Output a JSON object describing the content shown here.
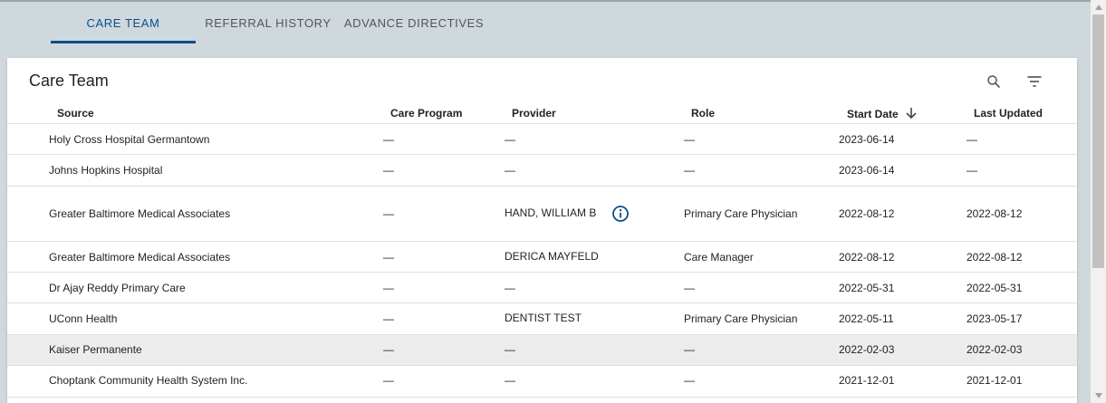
{
  "tabs": [
    {
      "label": "CARE TEAM",
      "active": true
    },
    {
      "label": "REFERRAL HISTORY",
      "active": false
    },
    {
      "label": "ADVANCE DIRECTIVES",
      "active": false
    }
  ],
  "card": {
    "title": "Care Team",
    "search_icon": "search-icon",
    "filter_icon": "filter-icon"
  },
  "table": {
    "columns": {
      "source": "Source",
      "care_program": "Care Program",
      "provider": "Provider",
      "role": "Role",
      "start_date": "Start Date",
      "last_updated": "Last Updated"
    },
    "sort": {
      "column": "Start Date",
      "direction": "descending",
      "icon": "arrow-down-icon"
    },
    "rows": [
      {
        "source": "Holy Cross Hospital Germantown",
        "care_program": "—",
        "provider": "—",
        "role": "—",
        "start_date": "2023-06-14",
        "last_updated": "—"
      },
      {
        "source": "Johns Hopkins Hospital",
        "care_program": "—",
        "provider": "—",
        "role": "—",
        "start_date": "2023-06-14",
        "last_updated": "—"
      },
      {
        "source": "Greater Baltimore Medical Associates",
        "care_program": "—",
        "provider": "HAND, WILLIAM B",
        "role": "Primary Care Physician",
        "start_date": "2022-08-12",
        "last_updated": "2022-08-12",
        "info_icon": true
      },
      {
        "source": "Greater Baltimore Medical Associates",
        "care_program": "—",
        "provider": "DERICA MAYFELD",
        "role": "Care Manager",
        "start_date": "2022-08-12",
        "last_updated": "2022-08-12"
      },
      {
        "source": "Dr Ajay Reddy Primary Care",
        "care_program": "—",
        "provider": "—",
        "role": "—",
        "start_date": "2022-05-31",
        "last_updated": "2022-05-31"
      },
      {
        "source": "UConn Health",
        "care_program": "—",
        "provider": "DENTIST TEST",
        "role": "Primary Care Physician",
        "start_date": "2022-05-11",
        "last_updated": "2023-05-17"
      },
      {
        "source": "Kaiser Permanente",
        "care_program": "—",
        "provider": "—",
        "role": "—",
        "start_date": "2022-02-03",
        "last_updated": "2022-02-03",
        "highlighted": true
      },
      {
        "source": "Choptank Community Health System Inc.",
        "care_program": "—",
        "provider": "—",
        "role": "—",
        "start_date": "2021-12-01",
        "last_updated": "2021-12-01"
      }
    ]
  },
  "colors": {
    "accent": "#0d4d8c",
    "tab_bar": "#cfd8dd",
    "row_highlight": "#ececec"
  }
}
